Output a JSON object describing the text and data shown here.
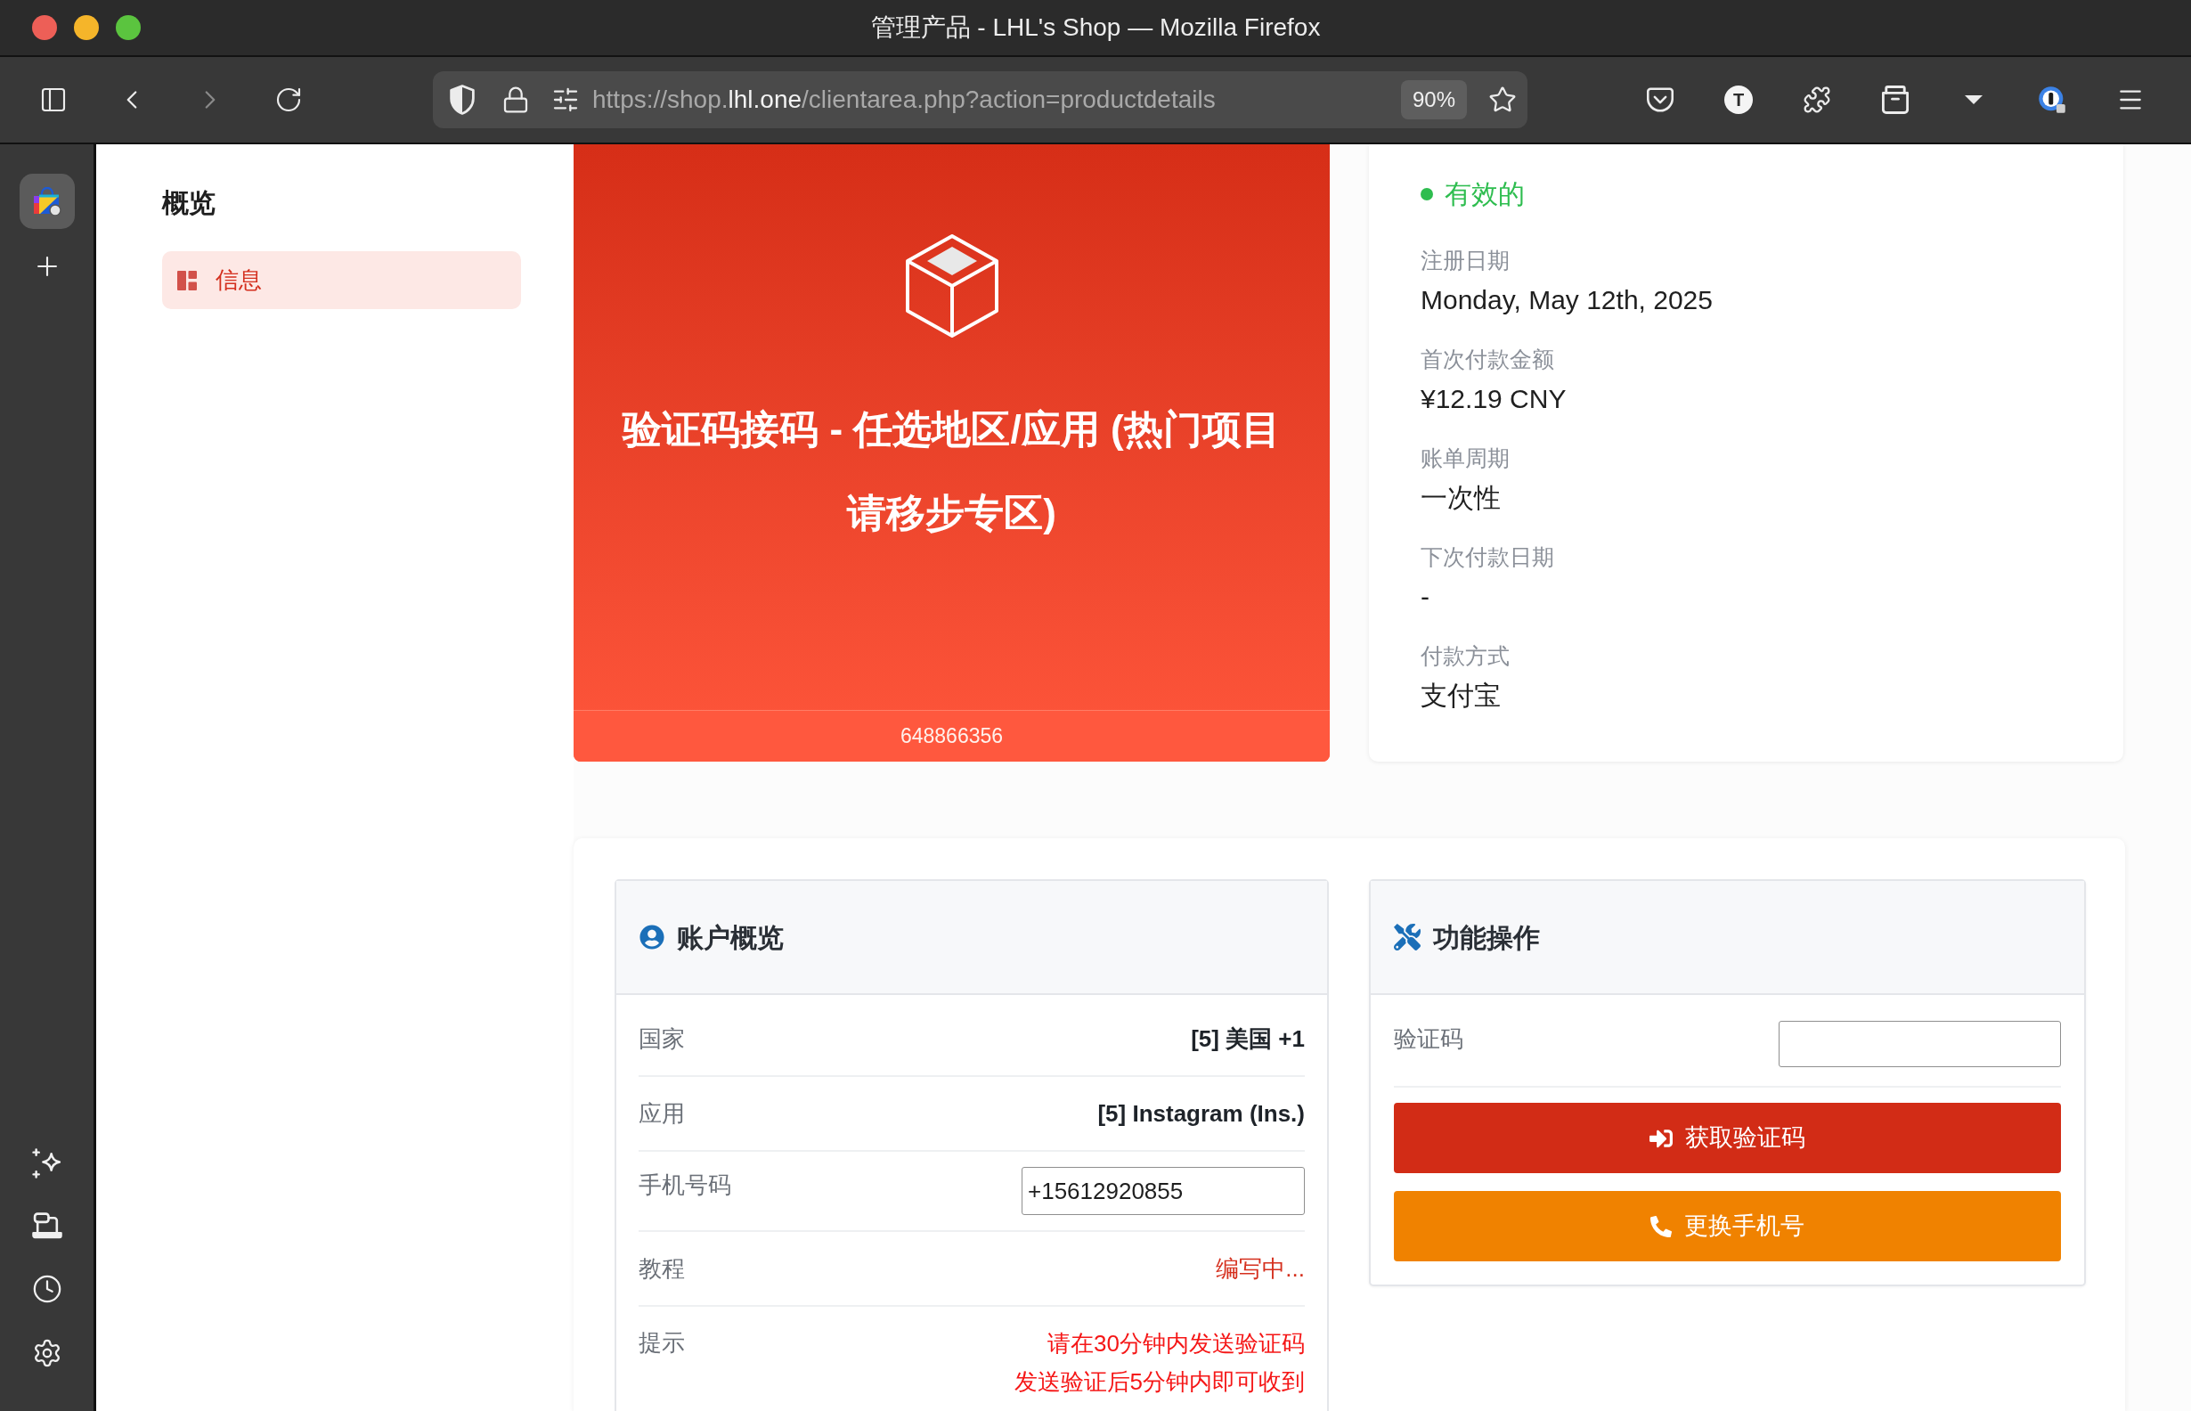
{
  "window": {
    "title": "管理产品 - LHL's Shop — Mozilla Firefox"
  },
  "toolbar": {
    "history_buttons": [
      {
        "kind": "back",
        "disabled": false
      },
      {
        "kind": "forward",
        "disabled": true
      }
    ],
    "url": {
      "prefix": "https://shop.",
      "domain": "lhl.one",
      "rest": "/clientarea.php?action=productdetails"
    },
    "zoom": "90%",
    "account_initial": "T"
  },
  "sidebar": {
    "apps": [
      {
        "selected": true
      }
    ]
  },
  "nav": {
    "heading": "概览",
    "items": [
      {
        "label": "信息",
        "selected": true
      }
    ]
  },
  "product": {
    "title": "验证码接码 - 任选地区/应用 (热门项目请移步专区)",
    "number": "648866356"
  },
  "details": {
    "status": {
      "label": "有效的",
      "active": true
    },
    "fields": [
      {
        "label": "注册日期",
        "value": "Monday, May 12th, 2025"
      },
      {
        "label": "首次付款金额",
        "value": "¥12.19 CNY"
      },
      {
        "label": "账单周期",
        "value": "一次性"
      },
      {
        "label": "下次付款日期",
        "value": "-"
      },
      {
        "label": "付款方式",
        "value": "支付宝"
      }
    ]
  },
  "account_panel": {
    "title": "账户概览",
    "rows": [
      {
        "kind": "text",
        "label": "国家",
        "value": "[5] 美国 +1"
      },
      {
        "kind": "text",
        "label": "应用",
        "value": "[5] Instagram (Ins.)"
      },
      {
        "kind": "input",
        "label": "手机号码",
        "value": "+15612920855"
      },
      {
        "kind": "link",
        "label": "教程",
        "value": "编写中..."
      },
      {
        "kind": "notice",
        "label": "提示",
        "lines": [
          "请在30分钟内发送验证码",
          "发送验证后5分钟内即可收到"
        ]
      }
    ]
  },
  "actions_panel": {
    "title": "功能操作",
    "code_field": {
      "label": "验证码"
    },
    "buttons": [
      {
        "kind": "primary",
        "label": "获取验证码"
      },
      {
        "kind": "warning",
        "label": "更换手机号"
      }
    ]
  }
}
